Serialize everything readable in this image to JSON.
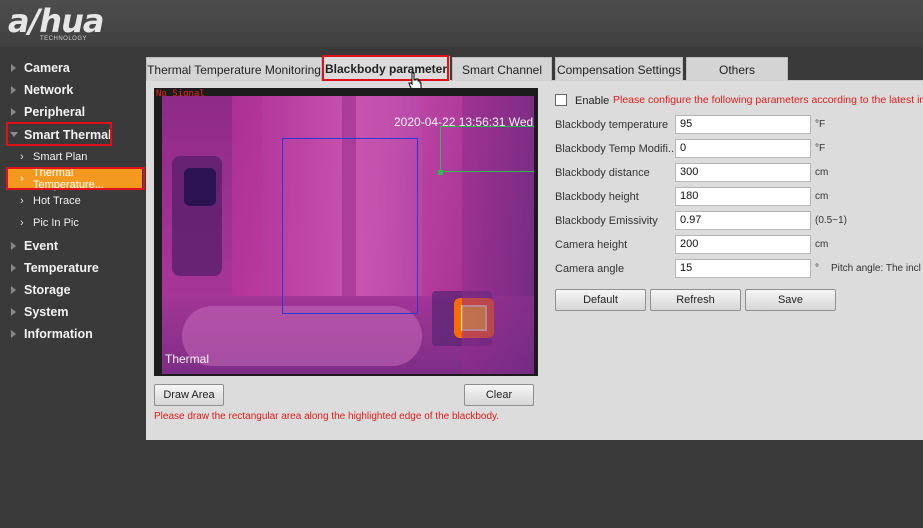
{
  "brand": {
    "name": "a/hua",
    "tagline": "TECHNOLOGY"
  },
  "sidebar": {
    "items": [
      {
        "label": "Camera"
      },
      {
        "label": "Network"
      },
      {
        "label": "Peripheral"
      },
      {
        "label": "Smart Thermal"
      }
    ],
    "sub_items": [
      {
        "label": "Smart Plan"
      },
      {
        "label": "Thermal Temperature..."
      },
      {
        "label": "Hot Trace"
      },
      {
        "label": "Pic In Pic"
      }
    ],
    "items_after": [
      {
        "label": "Event"
      },
      {
        "label": "Temperature"
      },
      {
        "label": "Storage"
      },
      {
        "label": "System"
      },
      {
        "label": "Information"
      }
    ]
  },
  "tabs": [
    {
      "label": "Thermal Temperature Monitoring"
    },
    {
      "label": "Blackbody parameter"
    },
    {
      "label": "Smart Channel"
    },
    {
      "label": "Compensation Settings"
    },
    {
      "label": "Others"
    }
  ],
  "video": {
    "timestamp": "2020-04-22 13:56:31 Wed",
    "channel_label": "Thermal",
    "overlay_text": "No Signal"
  },
  "buttons": {
    "draw_area": "Draw Area",
    "clear": "Clear",
    "default": "Default",
    "refresh": "Refresh",
    "save": "Save"
  },
  "hint": "Please draw the rectangular area along the highlighted edge of the blackbody.",
  "enable": {
    "label": "Enable",
    "checked": false,
    "warning": "Please configure the following parameters according to the latest ins"
  },
  "form": {
    "fields": [
      {
        "label": "Blackbody temperature",
        "value": "95",
        "unit": "°F"
      },
      {
        "label": "Blackbody Temp Modifi...",
        "value": "0",
        "unit": "°F"
      },
      {
        "label": "Blackbody distance",
        "value": "300",
        "unit": "cm"
      },
      {
        "label": "Blackbody height",
        "value": "180",
        "unit": "cm"
      },
      {
        "label": "Blackbody Emissivity",
        "value": "0.97",
        "unit": "(0.5~1)"
      },
      {
        "label": "Camera height",
        "value": "200",
        "unit": "cm"
      },
      {
        "label": "Camera angle",
        "value": "15",
        "unit": "°",
        "note": "Pitch angle: The incl"
      }
    ]
  },
  "colors": {
    "accent": "#f39a1e",
    "highlight": "#e0101a",
    "warning_text": "#e01c1c",
    "roi_box": "#2a3ad0",
    "roi_edge": "#22c04a"
  }
}
